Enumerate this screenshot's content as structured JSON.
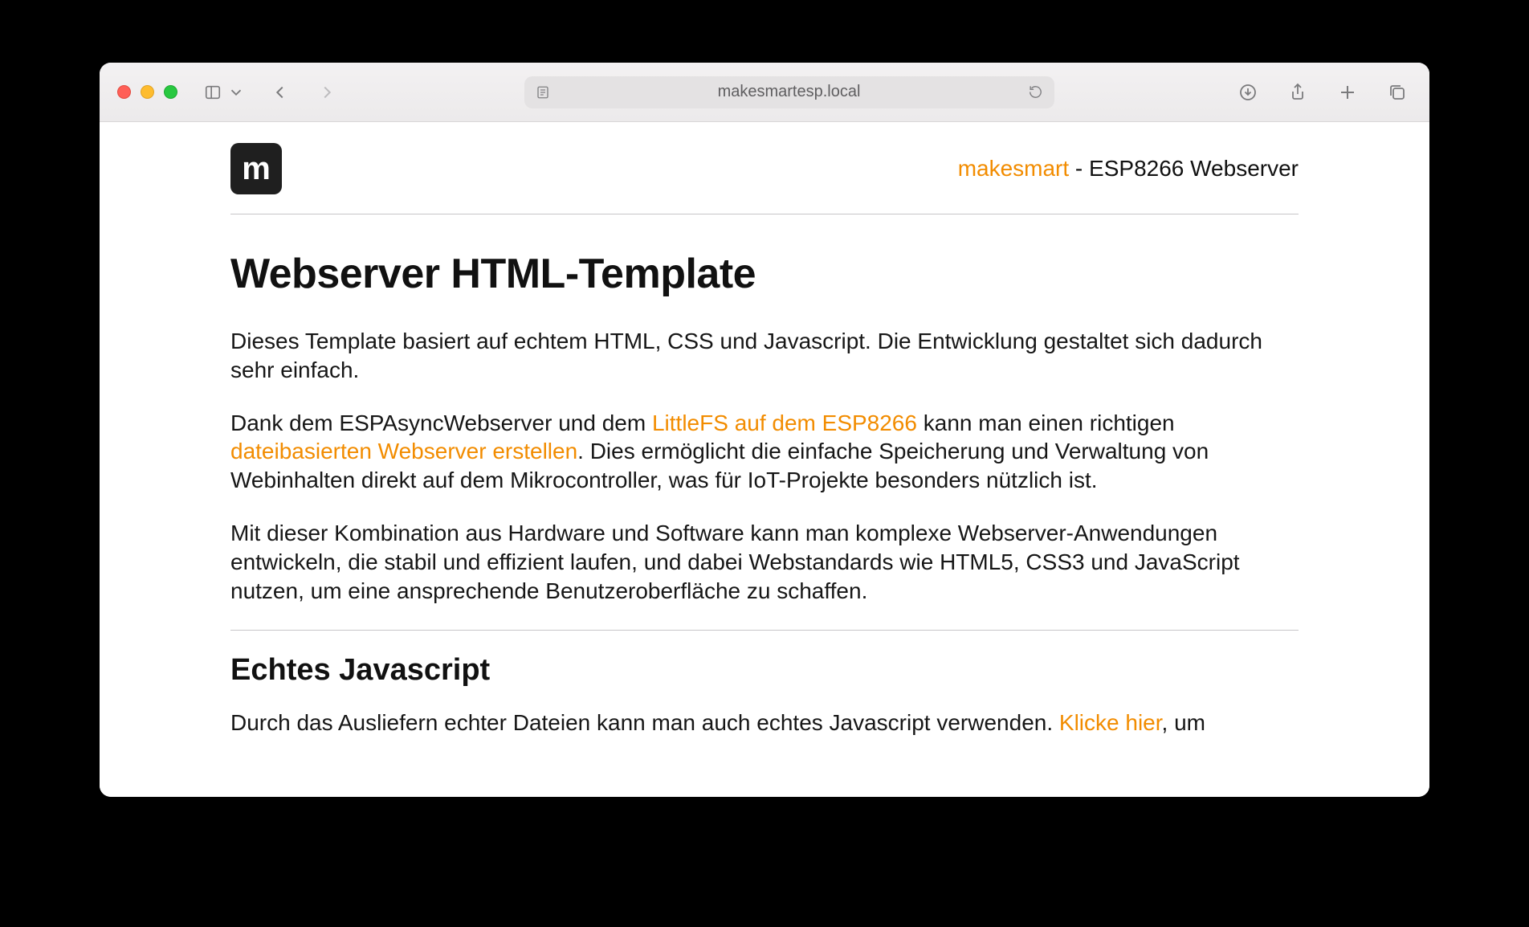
{
  "browser": {
    "address": "makesmartesp.local"
  },
  "header": {
    "logo_letter": "m",
    "brand": "makesmart",
    "title_suffix": " - ESP8266 Webserver"
  },
  "main": {
    "h1": "Webserver HTML-Template",
    "p1": "Dieses Template basiert auf echtem HTML, CSS und Javascript. Die Entwicklung gestaltet sich dadurch sehr einfach.",
    "p2_pre": "Dank dem ESPAsyncWebserver und dem ",
    "p2_link1": "LittleFS auf dem ESP8266",
    "p2_mid": " kann man einen richtigen ",
    "p2_link2": "dateibasierten Webserver erstellen",
    "p2_post": ". Dies ermöglicht die einfache Speicherung und Verwaltung von Webinhalten direkt auf dem Mikrocontroller, was für IoT-Projekte besonders nützlich ist.",
    "p3": "Mit dieser Kombination aus Hardware und Software kann man komplexe Webserver-Anwendungen entwickeln, die stabil und effizient laufen, und dabei Webstandards wie HTML5, CSS3 und JavaScript nutzen, um eine ansprechende Benutzeroberfläche zu schaffen.",
    "h2": "Echtes Javascript",
    "p4_pre": "Durch das Ausliefern echter Dateien kann man auch echtes Javascript verwenden. ",
    "p4_link": "Klicke hier",
    "p4_post": ", um"
  }
}
